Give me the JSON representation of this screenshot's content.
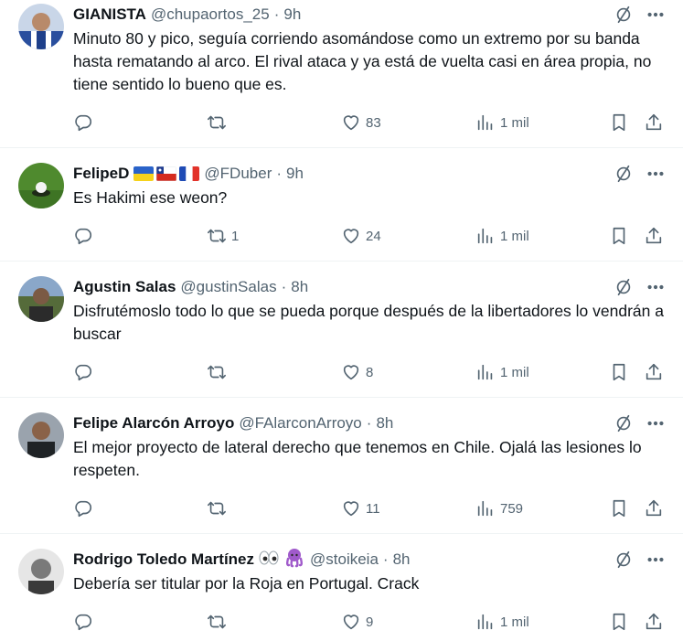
{
  "feed": {
    "colors": {
      "text": "#0f1419",
      "muted": "#536471",
      "divider": "#eff3f4"
    },
    "tweets": [
      {
        "name": "GIANISTA",
        "handle": "@chupaortos_25",
        "separator": "·",
        "time": "9h",
        "text": "Minuto 80 y pico, seguía corriendo asomándose como un extremo por su banda hasta rematando al arco. El rival ataca y ya está de vuelta casi en área propia, no tiene sentido lo bueno que es.",
        "replies": "",
        "reposts": "",
        "likes": "83",
        "views": "1 mil"
      },
      {
        "name": "FelipeD",
        "flags": [
          "ukraine-flag",
          "chile-flag",
          "france-flag"
        ],
        "handle": "@FDuber",
        "separator": "·",
        "time": "9h",
        "text": "Es Hakimi ese weon?",
        "replies": "",
        "reposts": "1",
        "likes": "24",
        "views": "1 mil"
      },
      {
        "name": "Agustin Salas",
        "handle": "@gustinSalas",
        "separator": "·",
        "time": "8h",
        "text": "Disfrutémoslo todo lo que se pueda porque después de la libertadores lo vendrán a buscar",
        "replies": "",
        "reposts": "",
        "likes": "8",
        "views": "1 mil"
      },
      {
        "name": "Felipe Alarcón Arroyo",
        "handle": "@FAlarconArroyo",
        "separator": "·",
        "time": "8h",
        "text": "El mejor proyecto de lateral derecho que tenemos en Chile. Ojalá las lesiones lo respeten.",
        "replies": "",
        "reposts": "",
        "likes": "11",
        "views": "759"
      },
      {
        "name": "Rodrigo Toledo Martínez",
        "name_emojis": [
          "eyes-emoji",
          "octopus-emoji"
        ],
        "handle": "@stoikeia",
        "separator": "·",
        "time": "8h",
        "text": "Debería ser titular por la Roja en Portugal. Crack",
        "replies": "",
        "reposts": "",
        "likes": "9",
        "views": "1 mil"
      }
    ]
  }
}
